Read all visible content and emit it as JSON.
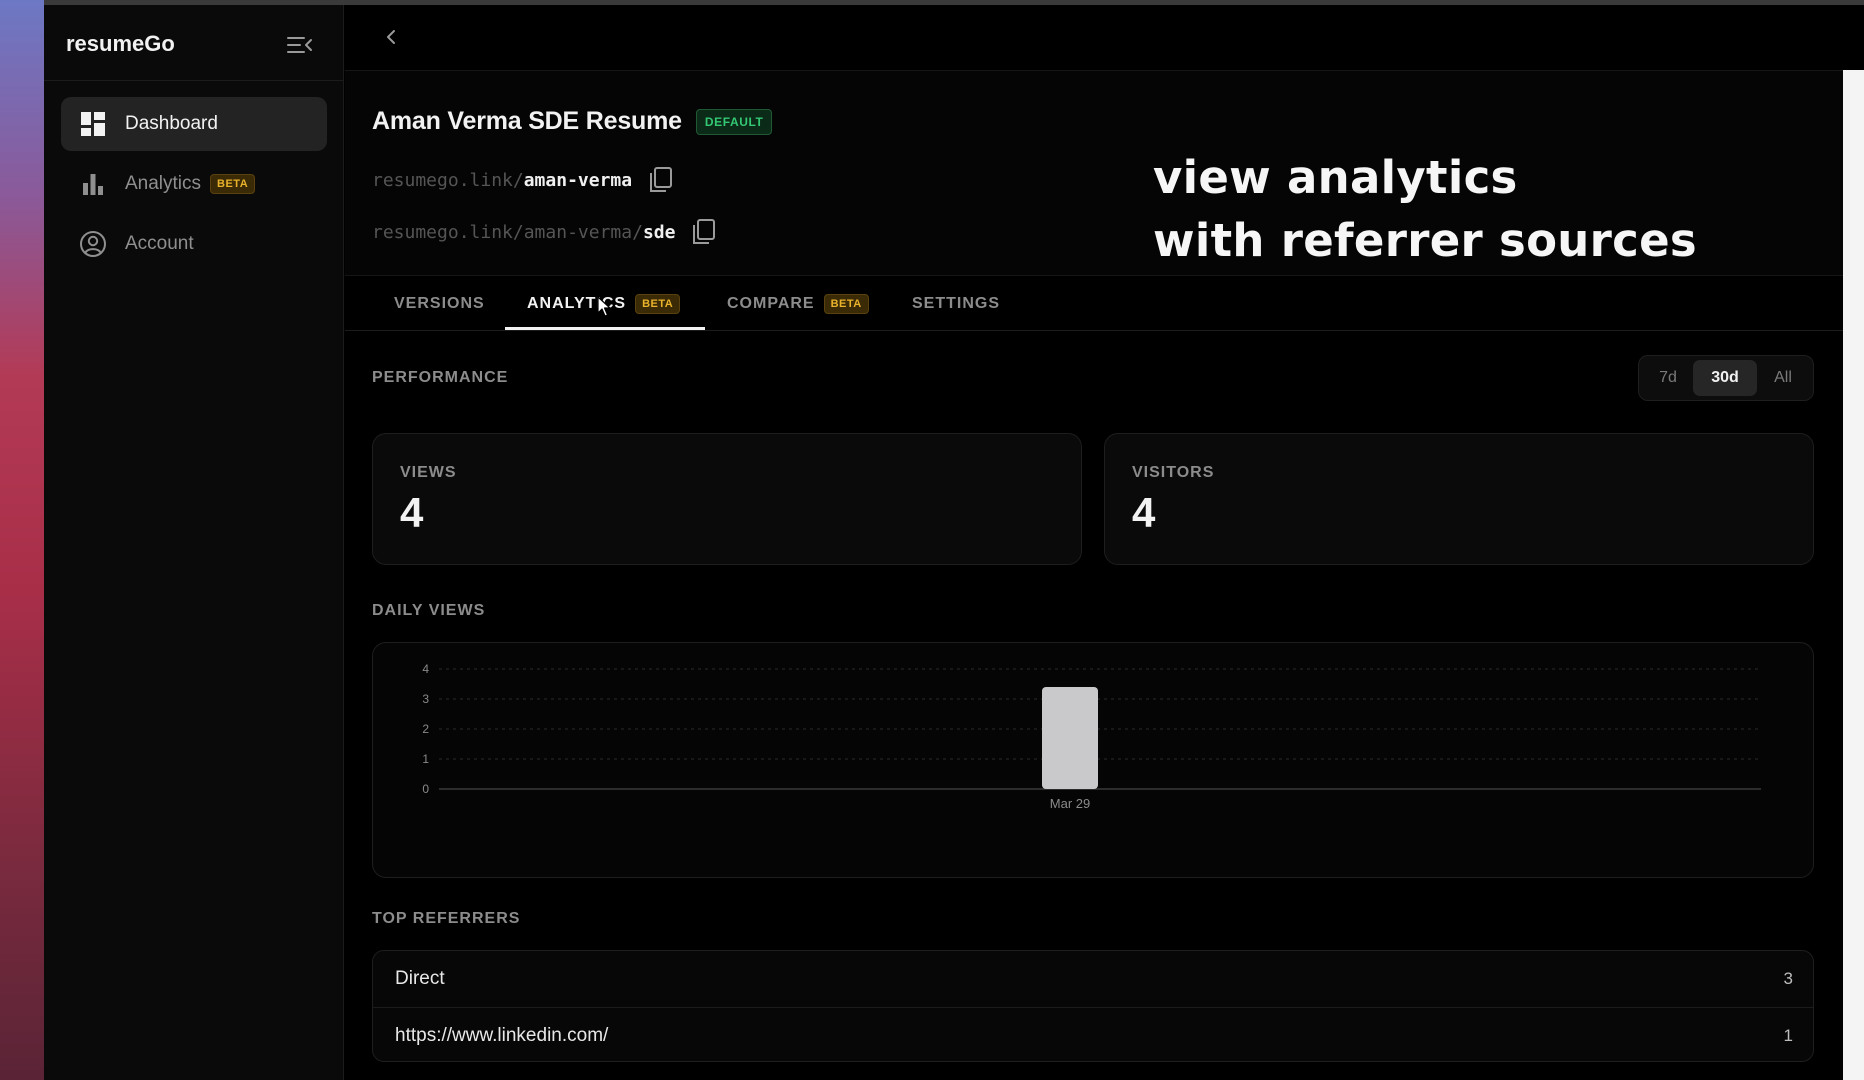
{
  "app": {
    "name": "resumeGo"
  },
  "sidebar": {
    "items": [
      {
        "label": "Dashboard",
        "icon": "dashboard-icon",
        "active": true
      },
      {
        "label": "Analytics",
        "icon": "bar-chart-icon",
        "badge": "BETA"
      },
      {
        "label": "Account",
        "icon": "user-circle-icon"
      }
    ]
  },
  "resume": {
    "title": "Aman Verma SDE Resume",
    "badge": "DEFAULT",
    "links": [
      {
        "prefix": "resumego.link/",
        "slug": "aman-verma"
      },
      {
        "prefix": "resumego.link/aman-verma/",
        "slug": "sde"
      }
    ]
  },
  "promo": {
    "line1": "view analytics",
    "line2": "with referrer sources"
  },
  "tabs": [
    {
      "label": "VERSIONS"
    },
    {
      "label": "ANALYTICS",
      "badge": "BETA",
      "active": true
    },
    {
      "label": "COMPARE",
      "badge": "BETA"
    },
    {
      "label": "SETTINGS"
    }
  ],
  "performance": {
    "label": "PERFORMANCE",
    "ranges": [
      "7d",
      "30d",
      "All"
    ],
    "selected_range": "30d",
    "views": {
      "label": "VIEWS",
      "value": "4"
    },
    "visitors": {
      "label": "VISITORS",
      "value": "4"
    }
  },
  "daily_views": {
    "label": "DAILY VIEWS"
  },
  "chart_data": {
    "type": "bar",
    "categories": [
      "Mar 29"
    ],
    "values": [
      3.4
    ],
    "yticks": [
      0,
      1,
      2,
      3,
      4
    ],
    "ylim": [
      0,
      4
    ],
    "grid": true,
    "bar_color": "#c9c9cc"
  },
  "referrers": {
    "label": "TOP REFERRERS",
    "rows": [
      {
        "source": "Direct",
        "count": "3"
      },
      {
        "source": "https://www.linkedin.com/",
        "count": "1"
      }
    ]
  },
  "colors": {
    "accent_beta": "#e9b22c",
    "default_green": "#34c774",
    "background": "#000000"
  }
}
